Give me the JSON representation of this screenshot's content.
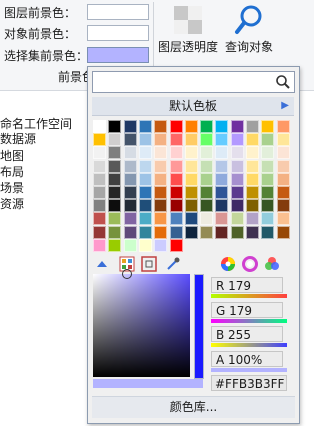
{
  "ribbon": {
    "layer_fg_label": "图层前景色：",
    "object_fg_label": "对象前景色：",
    "selection_fg_label": "选择集前景色：",
    "group_caption": "前景色",
    "transparency_label": "图层透明度",
    "query_label": "查询对象"
  },
  "tree": [
    "命名工作空间",
    "数据源",
    "地图",
    "布局",
    "场景",
    "资源"
  ],
  "popup": {
    "search_placeholder": "",
    "palette_title": "默认色板",
    "swatches": [
      [
        "#ffffff",
        "#000000",
        "#1f3864",
        "#2e75b6",
        "#c55a11",
        "#ff0000",
        "#ff8000",
        "#00b050",
        "#00b0f0",
        "#7030a0",
        "#a0a0a0",
        "#ffc000",
        "#ff9966"
      ],
      [
        "#ffc000",
        "#d0cece",
        "#44546a",
        "#9dc3e6",
        "#f4b183",
        "#ff6666",
        "#ffcc66",
        "#66ff66",
        "#66ccff",
        "#b399ff",
        "#ffd966",
        "#a9d18e",
        "#ffe699"
      ],
      [
        "#f2f2f2",
        "#7f7f7f",
        "#d6dce4",
        "#deebf7",
        "#fbe5d6",
        "#ffd1d1",
        "#fff2cc",
        "#e2f0d9",
        "#ddebf7",
        "#e4dfec",
        "#fff2cc",
        "#e2efda",
        "#fce4d6"
      ],
      [
        "#d9d9d9",
        "#595959",
        "#adb9ca",
        "#bdd7ee",
        "#f8cbad",
        "#ff9999",
        "#ffe699",
        "#c5e0b4",
        "#b4c7e7",
        "#c9c0e0",
        "#ffe699",
        "#c6e0b4",
        "#f8cbad"
      ],
      [
        "#bfbfbf",
        "#404040",
        "#8497b0",
        "#9dc3e6",
        "#f4b183",
        "#ff4d4d",
        "#ffd966",
        "#a9d18e",
        "#8faadc",
        "#a68fcf",
        "#ffd966",
        "#a9d18e",
        "#f4b183"
      ],
      [
        "#a6a6a6",
        "#262626",
        "#333f50",
        "#2e75b6",
        "#c55a11",
        "#cc0000",
        "#bf9000",
        "#548235",
        "#2f5597",
        "#5b3a8f",
        "#bf9000",
        "#548235",
        "#c55a11"
      ],
      [
        "#808080",
        "#0d0d0d",
        "#222a35",
        "#1f4e79",
        "#843c0c",
        "#990000",
        "#7f6000",
        "#375623",
        "#1f3864",
        "#3f2a66",
        "#7f6000",
        "#375623",
        "#843c0c"
      ],
      [
        "#c0504d",
        "#9bbb59",
        "#8064a2",
        "#4bacc6",
        "#f79646",
        "#4f81bd",
        "#1f497d",
        "#eeece1",
        "#d99694",
        "#c3d69b",
        "#b2a2c7",
        "#92cddc",
        "#fac08f"
      ],
      [
        "#953735",
        "#76923c",
        "#5f497a",
        "#31859c",
        "#e46c0a",
        "#366092",
        "#0f243e",
        "#948b54",
        "#632523",
        "#4f6228",
        "#3f3151",
        "#215968",
        "#974806"
      ],
      [
        "#ff99cc",
        "#99cc00",
        "#ccffcc",
        "#ffffcc",
        "#ccccff",
        "#ff0000"
      ]
    ],
    "r_label": "R 179",
    "g_label": "G 179",
    "b_label": "B 255",
    "a_label": "A 100%",
    "hex_label": "#FFB3B3FF",
    "library_label": "颜色库...",
    "colors": {
      "selected_preview": "#b3b3ff",
      "accent": "#3a6fd8"
    }
  }
}
